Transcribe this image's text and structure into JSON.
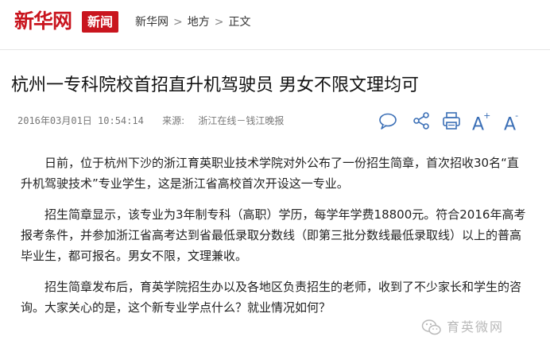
{
  "header": {
    "logo_text": "新华网",
    "logo_badge": "新闻",
    "breadcrumb": [
      "新华网",
      "地方",
      "正文"
    ],
    "separator": ">"
  },
  "article": {
    "title": "杭州一专科院校首招直升机驾驶员 男女不限文理均可",
    "date": "2016年03月01日 10:54:14",
    "source_label": "来源:",
    "source": "浙江在线－钱江晚报",
    "paragraphs": [
      "日前，位于杭州下沙的浙江育英职业技术学院对外公布了一份招生简章，首次招收30名“直升机驾驶技术”专业学生，这是浙江省高校首次开设这一专业。",
      "招生简章显示，该专业为3年制专科（高职）学历，每学年学费18800元。符合2016年高考报考条件，并参加浙江省高考达到省最低录取分数线（即第三批分数线最低录取线）以上的普高毕业生，都可报名。男女不限，文理兼收。",
      "招生简章发布后，育英学院招生办以及各地区负责招生的老师，收到了不少家长和学生的咨询。大家关心的是，这个新专业学点什么？就业情况如何？"
    ]
  },
  "tools": {
    "font_up_label": "A",
    "font_up_sup": "+",
    "font_down_label": "A",
    "font_down_sup": "-"
  },
  "watermark": {
    "text": "育英微网"
  },
  "colors": {
    "brand_red": "#c9151e",
    "tool_blue": "#3b6fb6",
    "meta_gray": "#777777"
  },
  "icons": [
    "comment-icon",
    "share-icon",
    "print-icon",
    "font-increase-icon",
    "font-decrease-icon",
    "wechat-icon"
  ]
}
